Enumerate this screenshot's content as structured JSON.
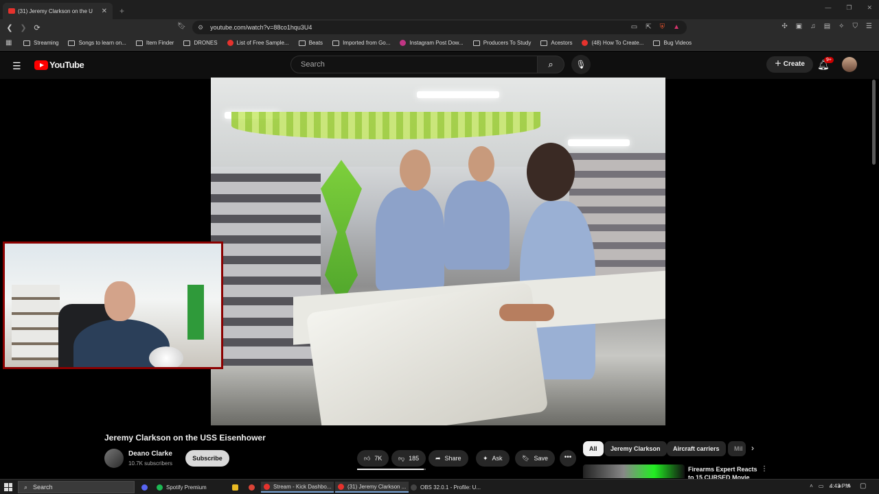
{
  "browser": {
    "tab": {
      "title": "(31) Jeremy Clarkson on the U",
      "close": "✕"
    },
    "new_tab": "+",
    "window_controls": [
      "—",
      "❐",
      "✕"
    ],
    "url": "youtube.com/watch?v=88co1hqu3U4",
    "bookmarks": [
      {
        "label": "Streaming",
        "icon": "folder"
      },
      {
        "label": "Songs to learn on...",
        "icon": "folder"
      },
      {
        "label": "Item Finder",
        "icon": "folder"
      },
      {
        "label": "DRONES",
        "icon": "folder"
      },
      {
        "label": "List of Free Sample...",
        "icon": "site"
      },
      {
        "label": "Beats",
        "icon": "folder"
      },
      {
        "label": "Imported from Go...",
        "icon": "folder"
      },
      {
        "label": "Instagram Post Dow...",
        "icon": "site"
      },
      {
        "label": "Producers To Study",
        "icon": "folder"
      },
      {
        "label": "Acestors",
        "icon": "folder"
      },
      {
        "label": "(48) How To Create...",
        "icon": "site"
      },
      {
        "label": "Bug Videos",
        "icon": "folder"
      }
    ]
  },
  "youtube": {
    "logo_text": "YouTube",
    "search_placeholder": "Search",
    "create_label": "Create",
    "notification_count": "9+",
    "accent_color": "#ff0000"
  },
  "video": {
    "title": "Jeremy Clarkson on the USS Eisenhower",
    "channel_name": "Deano Clarke",
    "subscribers": "10.7K subscribers",
    "subscribe_label": "Subscribe",
    "likes": "7K",
    "dislikes": "185",
    "like_ratio": 0.97,
    "share_label": "Share",
    "ask_label": "Ask",
    "save_label": "Save"
  },
  "chips": [
    "All",
    "Jeremy Clarkson",
    "Aircraft carriers",
    "Mil"
  ],
  "recommendation": {
    "title": "Firearms Expert Reacts to 15 CURSED Movie"
  },
  "taskbar": {
    "search_label": "Search",
    "items": [
      {
        "label": "Spotify Premium",
        "color": "#1db954"
      },
      {
        "label": "Stream - Kick Dashbo...",
        "color": "#e5322d"
      },
      {
        "label": "(31) Jeremy Clarkson ...",
        "color": "#e5322d"
      },
      {
        "label": "OBS 32.0.1 - Profile: U...",
        "color": "#444444"
      }
    ],
    "time": "4:43 PM"
  }
}
